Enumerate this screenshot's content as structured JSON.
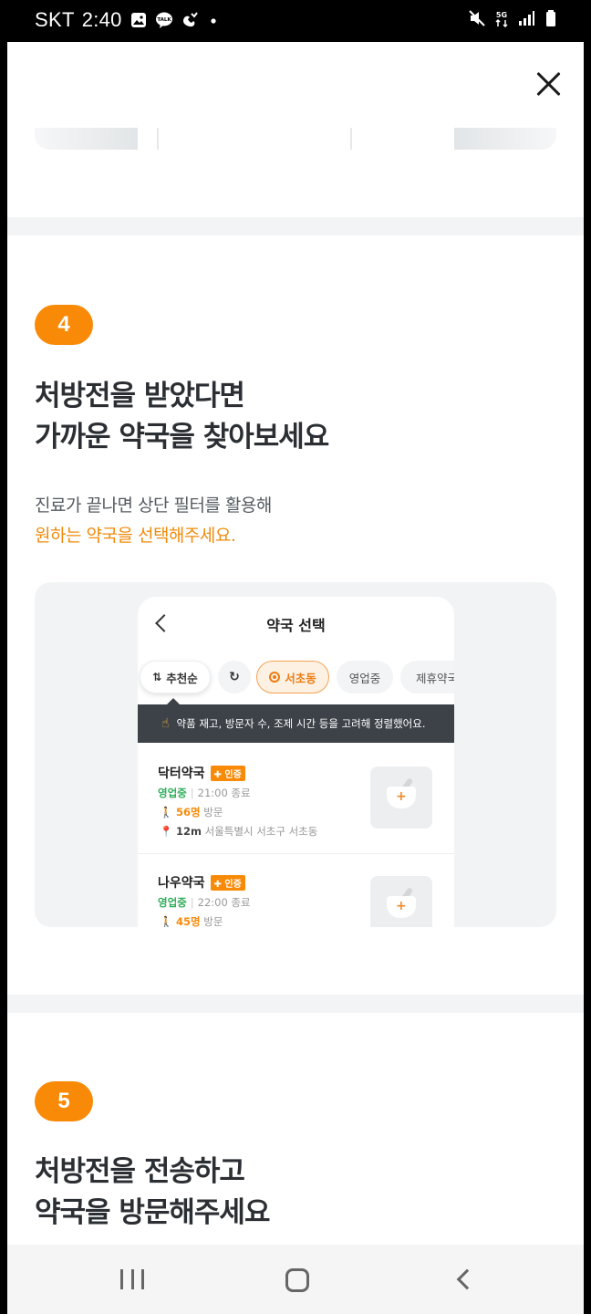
{
  "status_bar": {
    "carrier": "SKT",
    "time": "2:40",
    "talk_label": "TALK",
    "network_label": "5G"
  },
  "guide": {
    "step4": {
      "number": "4",
      "title_line1": "처방전을 받았다면",
      "title_line2": "가까운 약국을 찾아보세요",
      "desc_line1": "진료가 끝나면 상단 필터를 활용해",
      "desc_line2_highlight": "원하는 약국을 선택해주세요."
    },
    "step5": {
      "number": "5",
      "title_line1": "처방전을 전송하고",
      "title_line2": "약국을 방문해주세요"
    }
  },
  "illustration": {
    "screen_title": "약국 선택",
    "filters": {
      "sort_label": "추천순",
      "refresh_icon": "↻",
      "location_label": "서초동",
      "open_label": "영업중",
      "partner_label": "제휴약국"
    },
    "tooltip": "약품 재고, 방문자 수, 조제 시간 등을 고려해 정렬했어요.",
    "pharmacies": [
      {
        "name": "닥터약국",
        "badge": "인증",
        "status": "영업중",
        "close_time": "21:00 종료",
        "visitors": "56명",
        "visit_label": "방문",
        "distance": "12m",
        "address": "서울특별시 서초구 서초동"
      },
      {
        "name": "나우약국",
        "badge": "인증",
        "status": "영업중",
        "close_time": "22:00 종료",
        "visitors": "45명",
        "visit_label": "방문"
      }
    ]
  },
  "colors": {
    "accent": "#f98a08",
    "open_green": "#2fae5a",
    "title_text": "#2b2f33"
  }
}
